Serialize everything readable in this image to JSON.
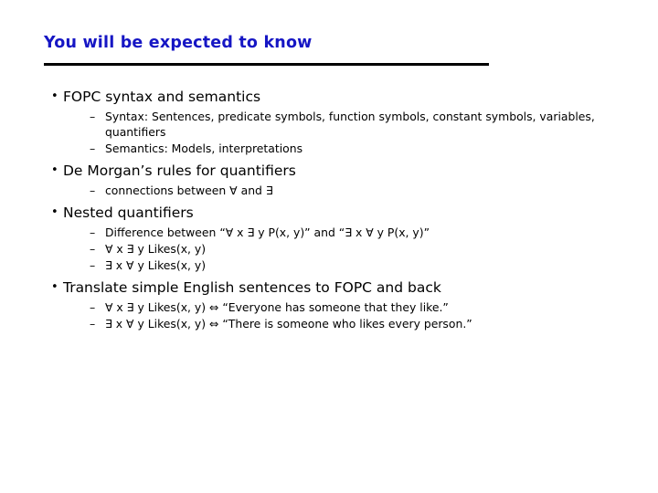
{
  "slide": {
    "title": "You will be expected to know",
    "title_color": "#1616c4",
    "rule_color": "#000000",
    "background": "#ffffff",
    "bullet_marker_level1": "•",
    "bullet_marker_level2": "–",
    "groups": [
      {
        "heading": "FOPC syntax and semantics",
        "items": [
          "Syntax: Sentences, predicate symbols, function symbols, constant symbols, variables, quantifiers",
          "Semantics: Models, interpretations"
        ]
      },
      {
        "heading": "De Morgan’s rules for quantifiers",
        "items": [
          "connections between ∀ and ∃"
        ]
      },
      {
        "heading": "Nested quantifiers",
        "items": [
          "Difference between “∀ x ∃ y P(x, y)” and “∃ x ∀ y P(x, y)”",
          "∀ x ∃ y Likes(x, y)",
          "∃ x ∀ y Likes(x, y)"
        ]
      },
      {
        "heading": "Translate simple English sentences to FOPC and back",
        "items": [
          "∀ x ∃ y Likes(x, y) ⇔ “Everyone has someone that they like.”",
          "∃ x ∀ y Likes(x, y) ⇔ “There is someone who likes every person.”"
        ]
      }
    ]
  }
}
